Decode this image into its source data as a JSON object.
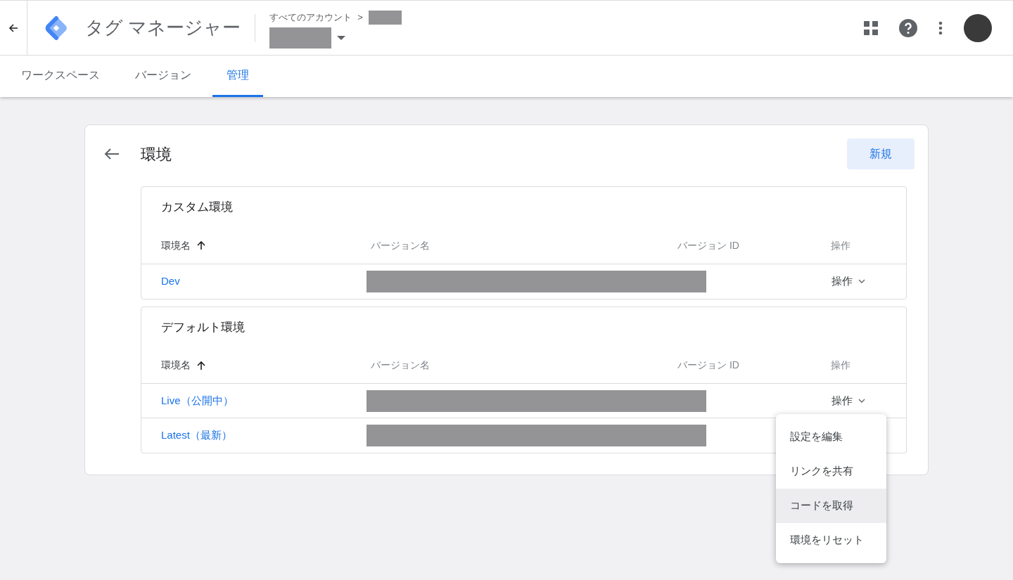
{
  "header": {
    "title": "タグ マネージャー",
    "breadcrumb": "すべてのアカウント",
    "breadcrumb_separator": ">"
  },
  "tabs": [
    {
      "label": "ワークスペース",
      "selected": false
    },
    {
      "label": "バージョン",
      "selected": false
    },
    {
      "label": "管理",
      "selected": true
    }
  ],
  "page": {
    "title": "環境",
    "new_button": "新規"
  },
  "sections": [
    {
      "title": "カスタム環境",
      "columns": [
        {
          "label": "環境名",
          "sorted": true
        },
        {
          "label": "バージョン名",
          "sorted": false
        },
        {
          "label": "バージョン ID",
          "sorted": false
        },
        {
          "label": "操作",
          "sorted": false
        }
      ],
      "rows": [
        {
          "name": "Dev",
          "actions": "操作"
        }
      ]
    },
    {
      "title": "デフォルト環境",
      "columns": [
        {
          "label": "環境名",
          "sorted": true
        },
        {
          "label": "バージョン名",
          "sorted": false
        },
        {
          "label": "バージョン ID",
          "sorted": false
        },
        {
          "label": "操作",
          "sorted": false
        }
      ],
      "rows": [
        {
          "name": "Live（公開中）",
          "actions": "操作",
          "menu": [
            {
              "label": "設定を編集",
              "highlighted": false
            },
            {
              "label": "リンクを共有",
              "highlighted": false
            },
            {
              "label": "コードを取得",
              "highlighted": true
            },
            {
              "label": "環境をリセット",
              "highlighted": false
            }
          ]
        },
        {
          "name": "Latest（最新）"
        }
      ]
    }
  ]
}
